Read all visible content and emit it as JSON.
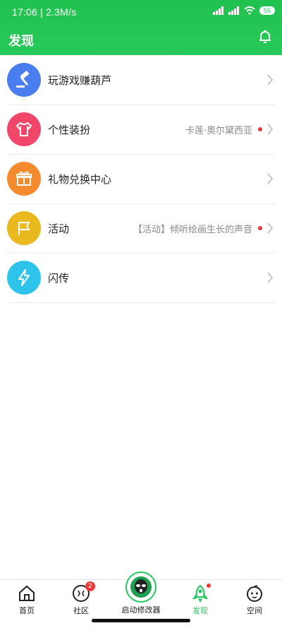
{
  "status_bar": {
    "time": "17:06",
    "speed": "2.3M/s",
    "battery": "55"
  },
  "header": {
    "title": "发现",
    "bell_icon": "bell-icon"
  },
  "list": [
    {
      "label": "玩游戏赚葫芦",
      "meta": "",
      "icon": "gavel-icon",
      "color": "#4a7df0",
      "dot": false
    },
    {
      "label": "个性装扮",
      "meta": "卡莲·奥尔黛西亚",
      "icon": "tshirt-icon",
      "color": "#f0466a",
      "dot": true
    },
    {
      "label": "礼物兑换中心",
      "meta": "",
      "icon": "gift-icon",
      "color": "#f58a2e",
      "dot": false
    },
    {
      "label": "活动",
      "meta": "【活动】倾听绘画生长的声音",
      "icon": "flag-icon",
      "color": "#eab91f",
      "dot": true
    },
    {
      "label": "闪传",
      "meta": "",
      "icon": "lightning-icon",
      "color": "#2ec3ea",
      "dot": false
    }
  ],
  "bottom_nav": {
    "home": "首页",
    "community": "社区",
    "community_badge": "2",
    "launcher": "启动修改器",
    "discover": "发现",
    "space": "空间"
  },
  "colors": {
    "accent": "#22c55e",
    "dot": "#e53935"
  }
}
